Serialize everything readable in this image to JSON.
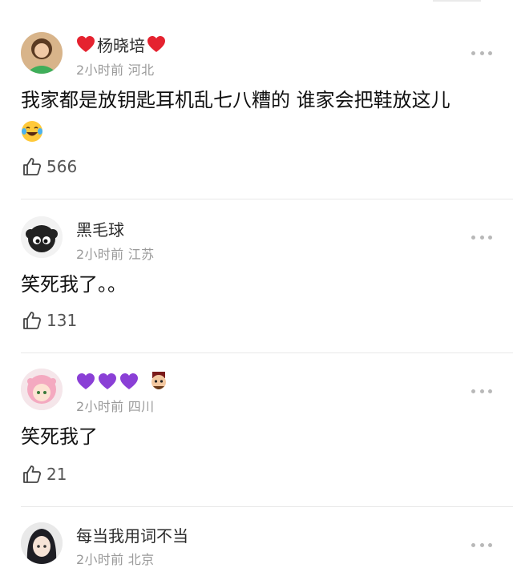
{
  "comments": [
    {
      "username": "杨晓培",
      "time": "2小时前",
      "location": "河北",
      "text_line1": "我家都是放钥匙耳机乱七八糟的 谁家会把鞋放这儿",
      "likes": "566",
      "name_decor": [
        "red-heart",
        "red-heart"
      ],
      "avatar": "woman-green-top-avatar"
    },
    {
      "username": "黑毛球",
      "time": "2小时前",
      "location": "江苏",
      "text_line1": "笑死我了。。",
      "likes": "131",
      "avatar": "black-fluffball-avatar"
    },
    {
      "username": "",
      "time": "2小时前",
      "location": "四川",
      "text_line1": "笑死我了",
      "likes": "21",
      "name_decor": [
        "purple-heart",
        "purple-heart",
        "purple-heart",
        "cartoon-face"
      ],
      "avatar": "pink-anime-girl-avatar"
    },
    {
      "username": "每当我用词不当",
      "time": "2小时前",
      "location": "北京",
      "avatar": "dark-hair-anime-avatar"
    }
  ],
  "colors": {
    "red_heart": "#e5222f",
    "purple_heart": "#8a3fd6",
    "meta": "#9a9a9a"
  }
}
